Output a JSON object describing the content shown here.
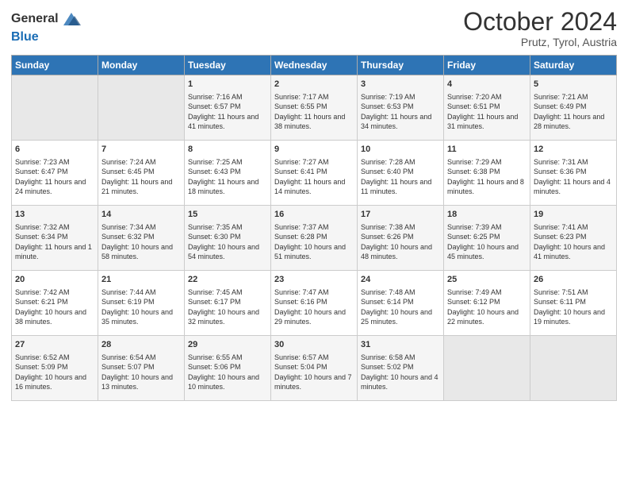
{
  "header": {
    "logo_general": "General",
    "logo_blue": "Blue",
    "month_title": "October 2024",
    "subtitle": "Prutz, Tyrol, Austria"
  },
  "weekdays": [
    "Sunday",
    "Monday",
    "Tuesday",
    "Wednesday",
    "Thursday",
    "Friday",
    "Saturday"
  ],
  "weeks": [
    [
      {
        "day": "",
        "content": ""
      },
      {
        "day": "",
        "content": ""
      },
      {
        "day": "1",
        "content": "Sunrise: 7:16 AM\nSunset: 6:57 PM\nDaylight: 11 hours and 41 minutes."
      },
      {
        "day": "2",
        "content": "Sunrise: 7:17 AM\nSunset: 6:55 PM\nDaylight: 11 hours and 38 minutes."
      },
      {
        "day": "3",
        "content": "Sunrise: 7:19 AM\nSunset: 6:53 PM\nDaylight: 11 hours and 34 minutes."
      },
      {
        "day": "4",
        "content": "Sunrise: 7:20 AM\nSunset: 6:51 PM\nDaylight: 11 hours and 31 minutes."
      },
      {
        "day": "5",
        "content": "Sunrise: 7:21 AM\nSunset: 6:49 PM\nDaylight: 11 hours and 28 minutes."
      }
    ],
    [
      {
        "day": "6",
        "content": "Sunrise: 7:23 AM\nSunset: 6:47 PM\nDaylight: 11 hours and 24 minutes."
      },
      {
        "day": "7",
        "content": "Sunrise: 7:24 AM\nSunset: 6:45 PM\nDaylight: 11 hours and 21 minutes."
      },
      {
        "day": "8",
        "content": "Sunrise: 7:25 AM\nSunset: 6:43 PM\nDaylight: 11 hours and 18 minutes."
      },
      {
        "day": "9",
        "content": "Sunrise: 7:27 AM\nSunset: 6:41 PM\nDaylight: 11 hours and 14 minutes."
      },
      {
        "day": "10",
        "content": "Sunrise: 7:28 AM\nSunset: 6:40 PM\nDaylight: 11 hours and 11 minutes."
      },
      {
        "day": "11",
        "content": "Sunrise: 7:29 AM\nSunset: 6:38 PM\nDaylight: 11 hours and 8 minutes."
      },
      {
        "day": "12",
        "content": "Sunrise: 7:31 AM\nSunset: 6:36 PM\nDaylight: 11 hours and 4 minutes."
      }
    ],
    [
      {
        "day": "13",
        "content": "Sunrise: 7:32 AM\nSunset: 6:34 PM\nDaylight: 11 hours and 1 minute."
      },
      {
        "day": "14",
        "content": "Sunrise: 7:34 AM\nSunset: 6:32 PM\nDaylight: 10 hours and 58 minutes."
      },
      {
        "day": "15",
        "content": "Sunrise: 7:35 AM\nSunset: 6:30 PM\nDaylight: 10 hours and 54 minutes."
      },
      {
        "day": "16",
        "content": "Sunrise: 7:37 AM\nSunset: 6:28 PM\nDaylight: 10 hours and 51 minutes."
      },
      {
        "day": "17",
        "content": "Sunrise: 7:38 AM\nSunset: 6:26 PM\nDaylight: 10 hours and 48 minutes."
      },
      {
        "day": "18",
        "content": "Sunrise: 7:39 AM\nSunset: 6:25 PM\nDaylight: 10 hours and 45 minutes."
      },
      {
        "day": "19",
        "content": "Sunrise: 7:41 AM\nSunset: 6:23 PM\nDaylight: 10 hours and 41 minutes."
      }
    ],
    [
      {
        "day": "20",
        "content": "Sunrise: 7:42 AM\nSunset: 6:21 PM\nDaylight: 10 hours and 38 minutes."
      },
      {
        "day": "21",
        "content": "Sunrise: 7:44 AM\nSunset: 6:19 PM\nDaylight: 10 hours and 35 minutes."
      },
      {
        "day": "22",
        "content": "Sunrise: 7:45 AM\nSunset: 6:17 PM\nDaylight: 10 hours and 32 minutes."
      },
      {
        "day": "23",
        "content": "Sunrise: 7:47 AM\nSunset: 6:16 PM\nDaylight: 10 hours and 29 minutes."
      },
      {
        "day": "24",
        "content": "Sunrise: 7:48 AM\nSunset: 6:14 PM\nDaylight: 10 hours and 25 minutes."
      },
      {
        "day": "25",
        "content": "Sunrise: 7:49 AM\nSunset: 6:12 PM\nDaylight: 10 hours and 22 minutes."
      },
      {
        "day": "26",
        "content": "Sunrise: 7:51 AM\nSunset: 6:11 PM\nDaylight: 10 hours and 19 minutes."
      }
    ],
    [
      {
        "day": "27",
        "content": "Sunrise: 6:52 AM\nSunset: 5:09 PM\nDaylight: 10 hours and 16 minutes."
      },
      {
        "day": "28",
        "content": "Sunrise: 6:54 AM\nSunset: 5:07 PM\nDaylight: 10 hours and 13 minutes."
      },
      {
        "day": "29",
        "content": "Sunrise: 6:55 AM\nSunset: 5:06 PM\nDaylight: 10 hours and 10 minutes."
      },
      {
        "day": "30",
        "content": "Sunrise: 6:57 AM\nSunset: 5:04 PM\nDaylight: 10 hours and 7 minutes."
      },
      {
        "day": "31",
        "content": "Sunrise: 6:58 AM\nSunset: 5:02 PM\nDaylight: 10 hours and 4 minutes."
      },
      {
        "day": "",
        "content": ""
      },
      {
        "day": "",
        "content": ""
      }
    ]
  ]
}
